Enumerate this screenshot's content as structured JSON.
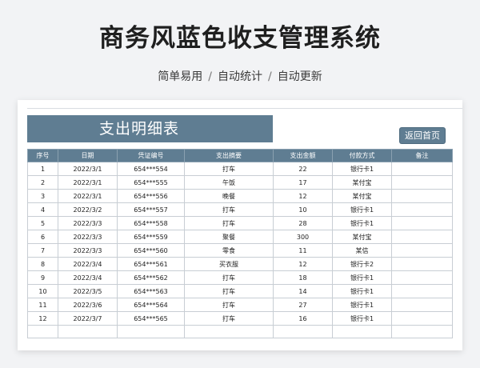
{
  "page": {
    "title": "商务风蓝色收支管理系统",
    "subtitle_items": [
      "简单易用",
      "自动统计",
      "自动更新"
    ],
    "subtitle_separator": "/"
  },
  "sheet": {
    "banner_title": "支出明细表",
    "back_button": "返回首页",
    "columns": [
      "序号",
      "日期",
      "凭证编号",
      "支出摘要",
      "支出金额",
      "付款方式",
      "备注"
    ],
    "rows": [
      [
        "1",
        "2022/3/1",
        "654***554",
        "打车",
        "22",
        "银行卡1",
        ""
      ],
      [
        "2",
        "2022/3/1",
        "654***555",
        "午饭",
        "17",
        "某付宝",
        ""
      ],
      [
        "3",
        "2022/3/1",
        "654***556",
        "晚餐",
        "12",
        "某付宝",
        ""
      ],
      [
        "4",
        "2022/3/2",
        "654***557",
        "打车",
        "10",
        "银行卡1",
        ""
      ],
      [
        "5",
        "2022/3/3",
        "654***558",
        "打车",
        "28",
        "银行卡1",
        ""
      ],
      [
        "6",
        "2022/3/3",
        "654***559",
        "聚餐",
        "300",
        "某付宝",
        ""
      ],
      [
        "7",
        "2022/3/3",
        "654***560",
        "零食",
        "11",
        "某信",
        ""
      ],
      [
        "8",
        "2022/3/4",
        "654***561",
        "买衣服",
        "12",
        "银行卡2",
        ""
      ],
      [
        "9",
        "2022/3/4",
        "654***562",
        "打车",
        "18",
        "银行卡1",
        ""
      ],
      [
        "10",
        "2022/3/5",
        "654***563",
        "打车",
        "14",
        "银行卡1",
        ""
      ],
      [
        "11",
        "2022/3/6",
        "654***564",
        "打车",
        "27",
        "银行卡1",
        ""
      ],
      [
        "12",
        "2022/3/7",
        "654***565",
        "打车",
        "16",
        "银行卡1",
        ""
      ]
    ]
  },
  "colors": {
    "header_blue": "#5f7d92",
    "background": "#f2f3f5"
  }
}
